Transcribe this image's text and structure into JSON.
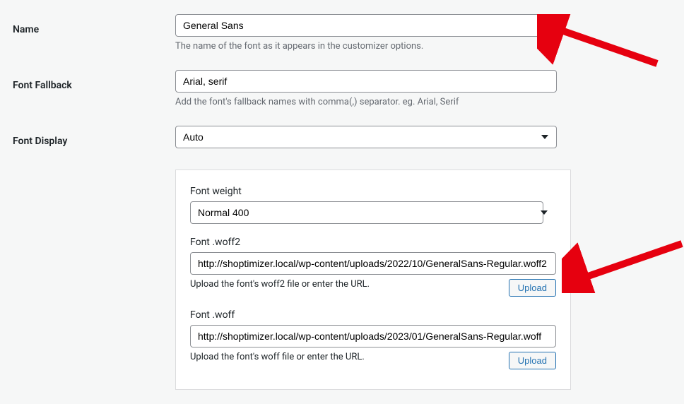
{
  "name": {
    "label": "Name",
    "value": "General Sans",
    "helper": "The name of the font as it appears in the customizer options."
  },
  "fallback": {
    "label": "Font Fallback",
    "value": "Arial, serif",
    "helper": "Add the font's fallback names with comma(,) separator. eg. Arial, Serif"
  },
  "display": {
    "label": "Font Display",
    "value": "Auto"
  },
  "weight": {
    "label": "Font weight",
    "value": "Normal 400"
  },
  "woff2": {
    "label": "Font .woff2",
    "value": "http://shoptimizer.local/wp-content/uploads/2022/10/GeneralSans-Regular.woff2",
    "helper": "Upload the font's woff2 file or enter the URL.",
    "button": "Upload"
  },
  "woff": {
    "label": "Font .woff",
    "value": "http://shoptimizer.local/wp-content/uploads/2023/01/GeneralSans-Regular.woff",
    "helper": "Upload the font's woff file or enter the URL.",
    "button": "Upload"
  }
}
